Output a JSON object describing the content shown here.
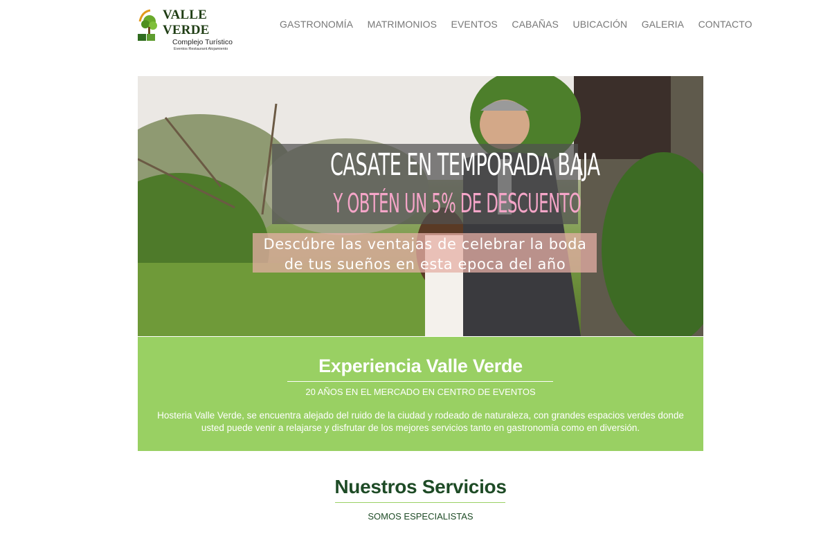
{
  "brand": {
    "name": "VALLE VERDE",
    "tagline": "Complejo Turístico",
    "subtagline": "Eventos Restaurant Alojamiento"
  },
  "nav": {
    "items": [
      "GASTRONOMÍA",
      "MATRIMONIOS",
      "EVENTOS",
      "CABAÑAS",
      "UBICACIÓN",
      "GALERIA",
      "CONTACTO"
    ]
  },
  "hero": {
    "title": "CASATE EN TEMPORADA BAJA",
    "subtitle": "Y OBTÉN UN 5% DE DESCUENTO",
    "description_line1": "Descúbre las ventajas de celebrar la boda",
    "description_line2": "de tus sueños en esta epoca del año"
  },
  "experience": {
    "title": "Experiencia Valle Verde",
    "subtitle": "20 AÑOS EN EL MERCADO EN CENTRO DE EVENTOS",
    "text": "Hosteria Valle Verde, se encuentra alejado del ruido de la ciudad y rodeado de naturaleza, con grandes espacios verdes donde usted puede venir a relajarse y disfrutar de los mejores servicios tanto en gastronomía como en diversión."
  },
  "services": {
    "title": "Nuestros Servicios",
    "subtitle": "SOMOS ESPECIALISTAS"
  },
  "colors": {
    "accent_green": "#99d063",
    "dark_green": "#1e4b26",
    "nav_text": "#777777",
    "hero_pink": "#f5a5c8"
  }
}
